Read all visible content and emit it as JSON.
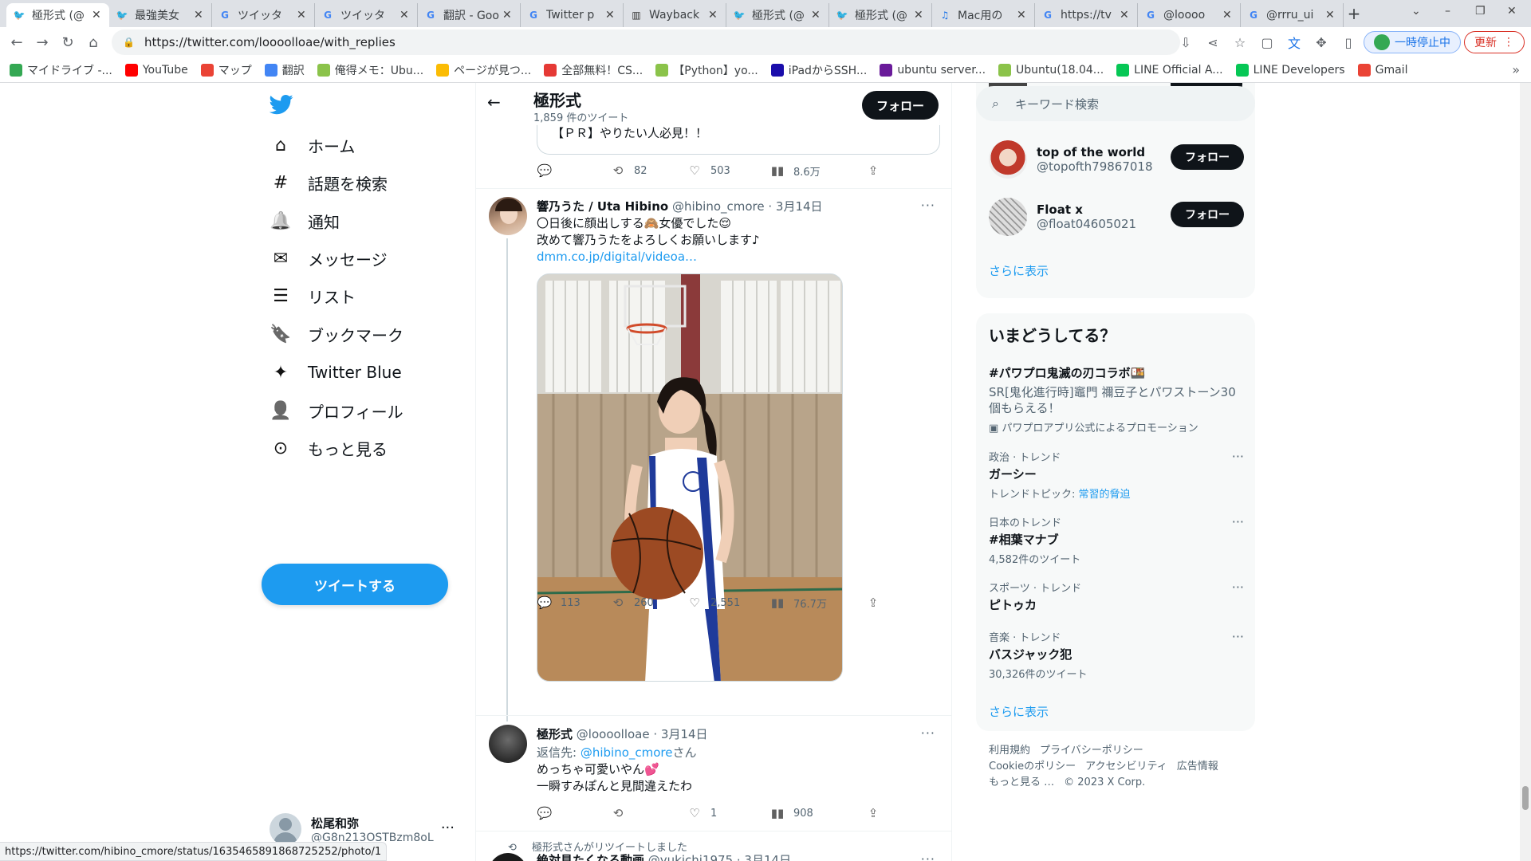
{
  "browser": {
    "tabs": [
      {
        "title": "極形式 (@",
        "icon": "twitter",
        "active": true
      },
      {
        "title": "最強美女",
        "icon": "twitter"
      },
      {
        "title": "ツイッタ",
        "icon": "google"
      },
      {
        "title": "ツイッタ",
        "icon": "google"
      },
      {
        "title": "翻訳 - Goo",
        "icon": "google"
      },
      {
        "title": "Twitter p",
        "icon": "google"
      },
      {
        "title": "Wayback",
        "icon": "wayback"
      },
      {
        "title": "極形式 (@",
        "icon": "twitter"
      },
      {
        "title": "極形式 (@",
        "icon": "twitter"
      },
      {
        "title": "Mac用の",
        "icon": "mac"
      },
      {
        "title": "https://tv",
        "icon": "google"
      },
      {
        "title": "@loooo",
        "icon": "google"
      },
      {
        "title": "@rrru_ui",
        "icon": "google"
      }
    ],
    "url": "https://twitter.com/loooolloae/with_replies",
    "pause_label": "一時停止中",
    "update_label": "更新",
    "bookmarks": [
      {
        "label": "マイドライブ -...",
        "color": "#34a853"
      },
      {
        "label": "YouTube",
        "color": "#ff0000"
      },
      {
        "label": "マップ",
        "color": "#ea4335"
      },
      {
        "label": "翻訳",
        "color": "#4285f4"
      },
      {
        "label": "俺得メモ：Ubu...",
        "color": "#8bc34a"
      },
      {
        "label": "ページが見つ...",
        "color": "#fbbc04"
      },
      {
        "label": "全部無料！CS...",
        "color": "#e53935"
      },
      {
        "label": "【Python】yo...",
        "color": "#8bc34a"
      },
      {
        "label": "iPadからSSH...",
        "color": "#1a0dab"
      },
      {
        "label": "ubuntu server...",
        "color": "#6a1b9a"
      },
      {
        "label": "Ubuntu(18.04...",
        "color": "#8bc34a"
      },
      {
        "label": "LINE Official A...",
        "color": "#06c755"
      },
      {
        "label": "LINE Developers",
        "color": "#06c755"
      },
      {
        "label": "Gmail",
        "color": "#ea4335"
      }
    ],
    "status_url": "https://twitter.com/hibino_cmore/status/1635465891868725252/photo/1"
  },
  "nav": {
    "items": [
      "ホーム",
      "話題を検索",
      "通知",
      "メッセージ",
      "リスト",
      "ブックマーク",
      "Twitter Blue",
      "プロフィール",
      "もっと見る"
    ],
    "icons": [
      "home-icon",
      "hashtag-icon",
      "bell-icon",
      "mail-icon",
      "list-icon",
      "bookmark-icon",
      "twitter-blue-icon",
      "profile-icon",
      "more-circle-icon"
    ],
    "tweet_button": "ツイートする",
    "account": {
      "name": "松尾和弥",
      "handle": "@G8n213OSTBzm8oL"
    }
  },
  "profile": {
    "name": "極形式",
    "tweet_count": "1,859 件のツイート",
    "follow_label": "フォロー"
  },
  "timeline": {
    "promo_text": "【ＰＲ】やりたい人必見！！",
    "promo_actions": {
      "reply": "",
      "retweet": "82",
      "like": "503",
      "views": "8.6万"
    },
    "tweet1": {
      "name": "響乃うた / Uta Hibino",
      "handle": "@hibino_cmore · 3月14日",
      "line1": "〇日後に顔出しする🙈女優でした😌",
      "line2": "改めて響乃うたをよろしくお願いします♪",
      "link": "dmm.co.jp/digital/videoa…",
      "actions": {
        "reply": "113",
        "retweet": "260",
        "like": "2,551",
        "views": "76.7万"
      }
    },
    "tweet2": {
      "name": "極形式",
      "handle": "@loooolloae · 3月14日",
      "reply_prefix": "返信先: ",
      "reply_to": "@hibino_cmore",
      "reply_suffix": "さん",
      "line1": "めっちゃ可愛いやん💕",
      "line2": "一瞬すみぽんと見間違えたわ",
      "actions": {
        "reply": "",
        "retweet": "",
        "like": "1",
        "views": "908"
      }
    },
    "retweet_note": "極形式さんがリツイートしました",
    "tweet3": {
      "name": "絶対見たくなる動画",
      "handle": "@yukichi1975 · 3月14日"
    }
  },
  "sidebar": {
    "search_placeholder": "キーワード検索",
    "who": [
      {
        "name": "top of the world",
        "handle": "@topofth79867018",
        "btn": "フォロー"
      },
      {
        "name": "Float x",
        "handle": "@float04605021",
        "btn": "フォロー"
      }
    ],
    "who_show_more": "さらに表示",
    "trends_title": "いまどうしてる？",
    "promo_trend": {
      "title": "#パワプロ鬼滅の刃コラボ🍱",
      "desc": "SR[鬼化進行時]竈門 禰豆子とパワストーン30個もらえる！",
      "by": "パワプロアプリ公式によるプロモーション"
    },
    "trends": [
      {
        "cat": "政治 · トレンド",
        "title": "ガーシー",
        "sub_prefix": "トレンドトピック: ",
        "sub_link": "常習的脅迫"
      },
      {
        "cat": "日本のトレンド",
        "title": "#相葉マナブ",
        "sub": "4,582件のツイート"
      },
      {
        "cat": "スポーツ · トレンド",
        "title": "ピトゥカ",
        "sub": ""
      },
      {
        "cat": "音楽 · トレンド",
        "title": "バスジャック犯",
        "sub": "30,326件のツイート"
      }
    ],
    "trends_show_more": "さらに表示",
    "footer": [
      "利用規約",
      "プライバシーポリシー",
      "Cookieのポリシー",
      "アクセシビリティ",
      "広告情報",
      "もっと見る …",
      "© 2023 X Corp."
    ]
  }
}
